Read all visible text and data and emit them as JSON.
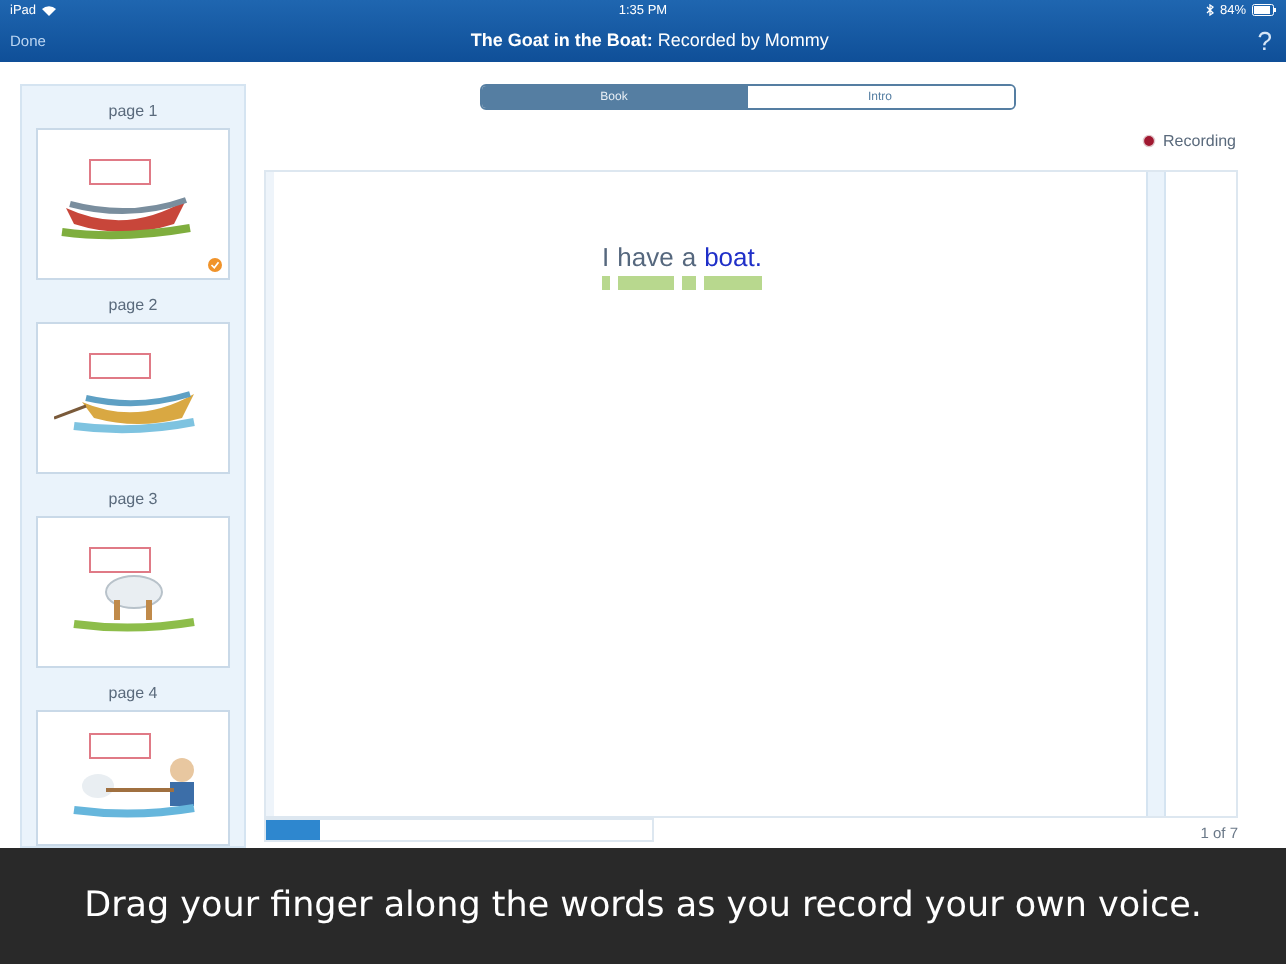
{
  "status_bar": {
    "device": "iPad",
    "time": "1:35 PM",
    "battery": "84%"
  },
  "nav_bar": {
    "left_button": "Done",
    "title": "The Goat in the Boat:",
    "subtitle": "Recorded by Mommy",
    "help": "?"
  },
  "pages": [
    {
      "label": "page 1",
      "recorded": true
    },
    {
      "label": "page 2",
      "recorded": false
    },
    {
      "label": "page 3",
      "recorded": false
    },
    {
      "label": "page 4",
      "recorded": false
    }
  ],
  "tabs": [
    {
      "label": "Book",
      "selected": true
    },
    {
      "label": "Intro",
      "selected": false
    }
  ],
  "recording_label": "Recording",
  "sentence": [
    {
      "word": "I",
      "highlighted": false
    },
    {
      "word": "have",
      "highlighted": false
    },
    {
      "word": "a",
      "highlighted": false
    },
    {
      "word": "boat.",
      "highlighted": true
    }
  ],
  "progress": {
    "level": 0.14
  },
  "page_count": "1 of 7",
  "caption": "Drag your finger along the words as you record your own voice."
}
